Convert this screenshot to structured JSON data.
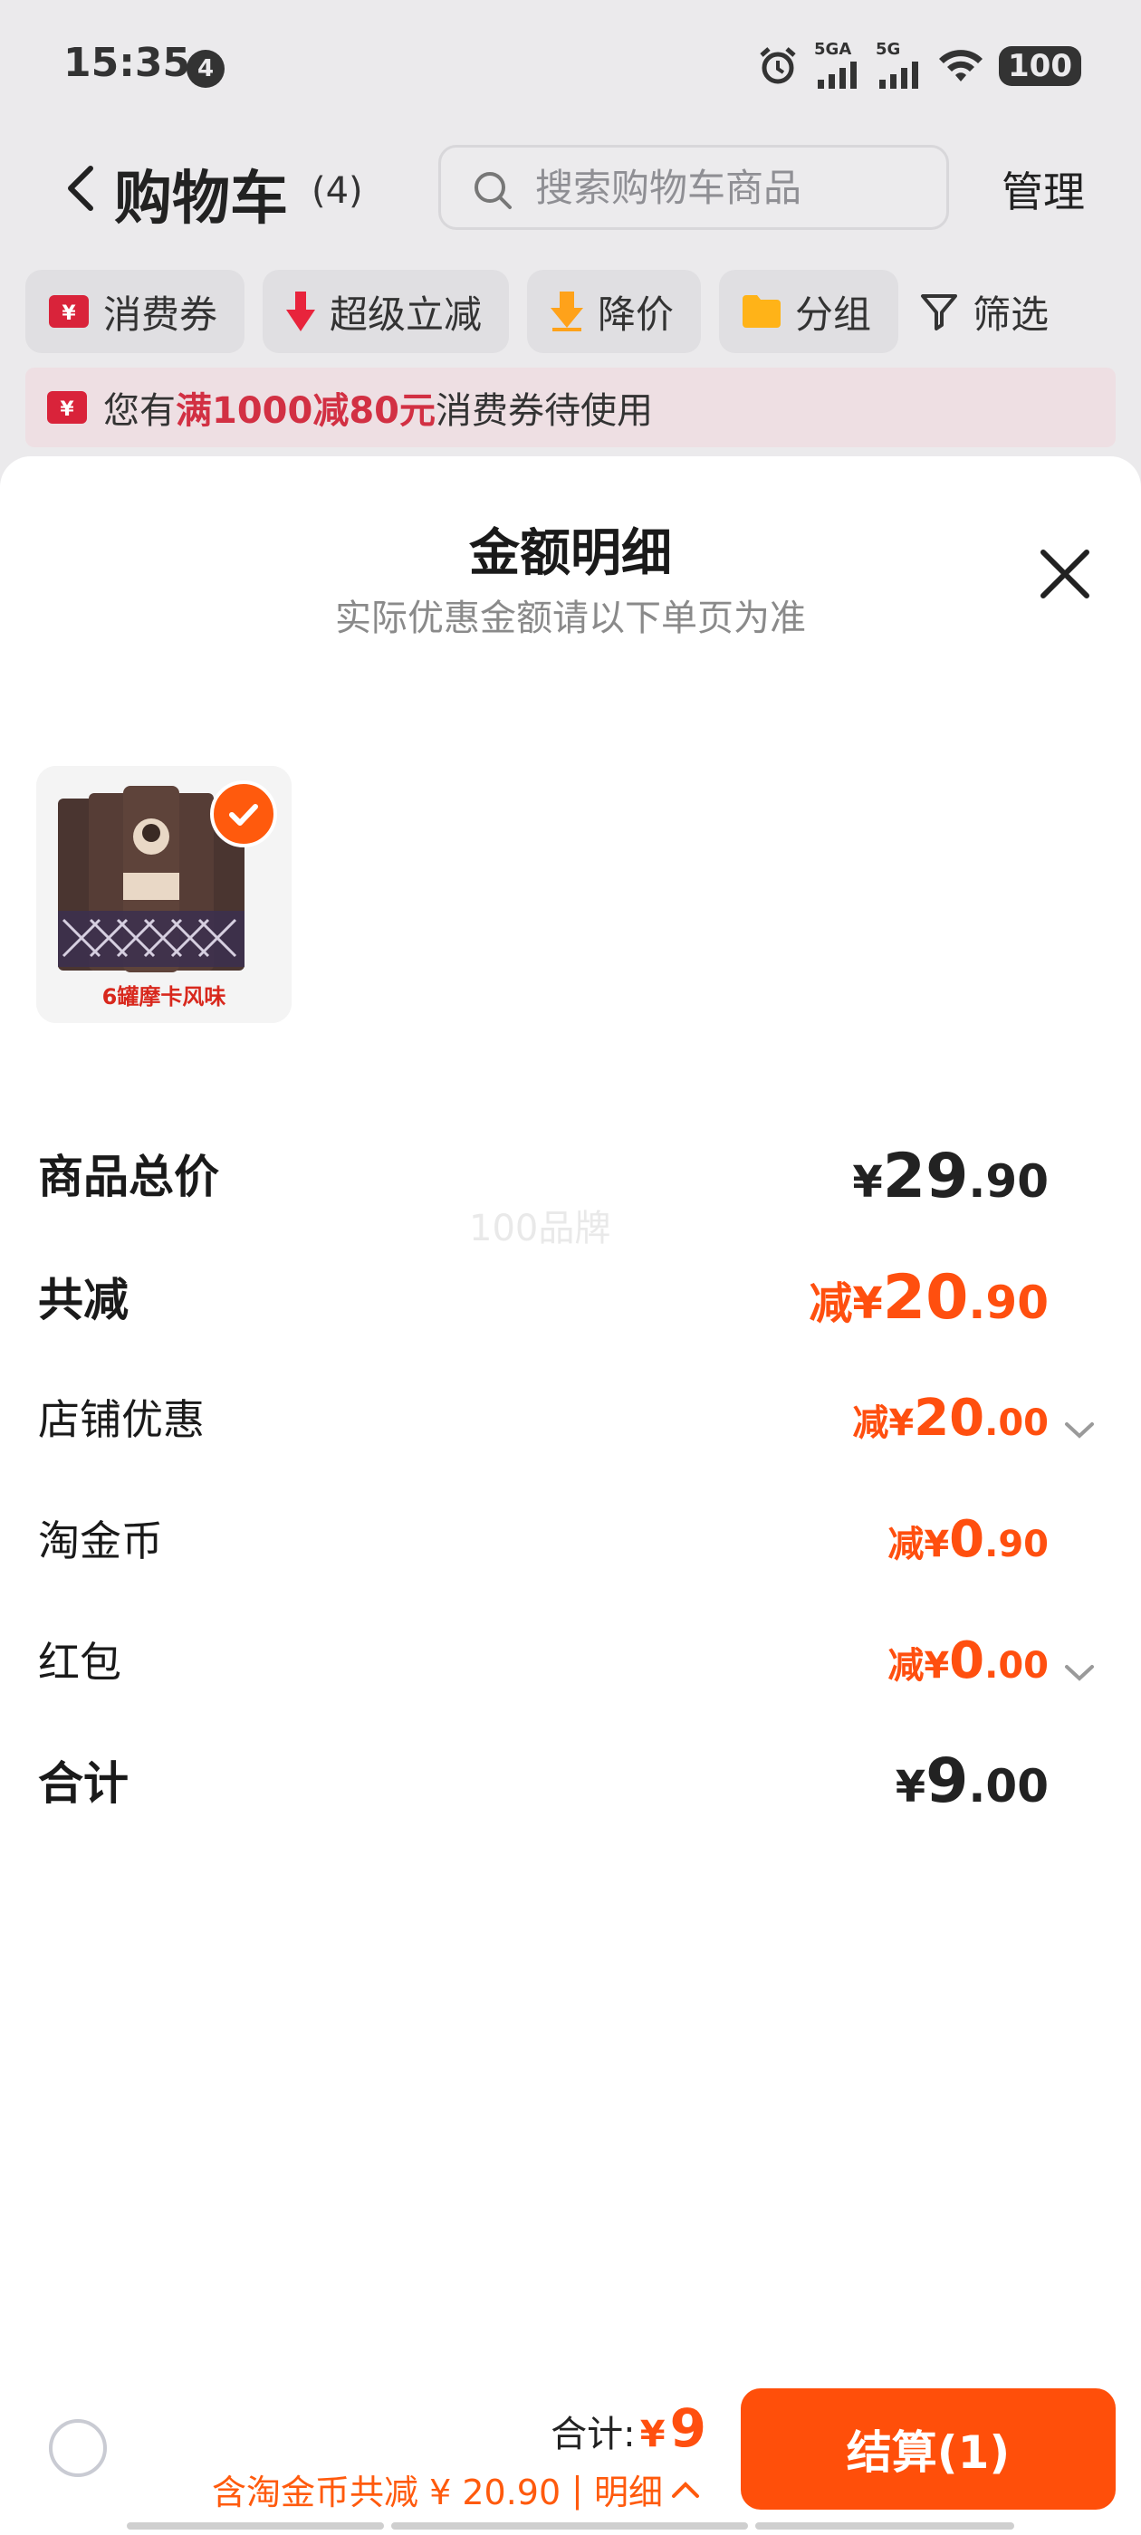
{
  "status_bar": {
    "time": "15:35",
    "notification_count": "4",
    "network_1": "5GA",
    "network_2": "5G",
    "battery": "100"
  },
  "header": {
    "title": "购物车",
    "count": "(4)",
    "search_placeholder": "搜索购物车商品",
    "manage_label": "管理"
  },
  "filters": [
    {
      "label": "消费券",
      "icon": "coupon-icon"
    },
    {
      "label": "超级立减",
      "icon": "arrow-down-icon"
    },
    {
      "label": "降价",
      "icon": "price-drop-icon"
    },
    {
      "label": "分组",
      "icon": "folder-icon"
    },
    {
      "label": "筛选",
      "icon": "filter-icon"
    }
  ],
  "coupon_banner": {
    "prefix": "您有",
    "highlight": "满1000减80元",
    "suffix": "消费券待使用"
  },
  "sheet": {
    "title": "金额明细",
    "subtitle": "实际优惠金额请以下单页为准",
    "product_caption": "6罐摩卡风味",
    "watermark": "100品牌",
    "rows": {
      "total_price": {
        "label": "商品总价",
        "prefix": "",
        "currency": "¥",
        "int": "29",
        "dec": ".90"
      },
      "total_discount": {
        "label": "共减",
        "prefix": "减",
        "currency": "¥",
        "int": "20",
        "dec": ".90"
      },
      "shop_discount": {
        "label": "店铺优惠",
        "prefix": "减",
        "currency": "¥",
        "int": "20",
        "dec": ".00"
      },
      "coins": {
        "label": "淘金币",
        "prefix": "减",
        "currency": "¥",
        "int": "0",
        "dec": ".90"
      },
      "red_packet": {
        "label": "红包",
        "prefix": "减",
        "currency": "¥",
        "int": "0",
        "dec": ".00"
      },
      "grand_total": {
        "label": "合计",
        "prefix": "",
        "currency": "¥",
        "int": "9",
        "dec": ".00"
      }
    }
  },
  "bottom_bar": {
    "total_label": "合计:",
    "currency": "¥",
    "total_amount": "9",
    "saving_text": "含淘金币共减 ¥ 20.90",
    "detail_label": "明细",
    "checkout_label": "结算(1)"
  },
  "colors": {
    "accent": "#ff4f0f",
    "banner_highlight": "#d23043",
    "backdrop": "#ebeaec"
  }
}
